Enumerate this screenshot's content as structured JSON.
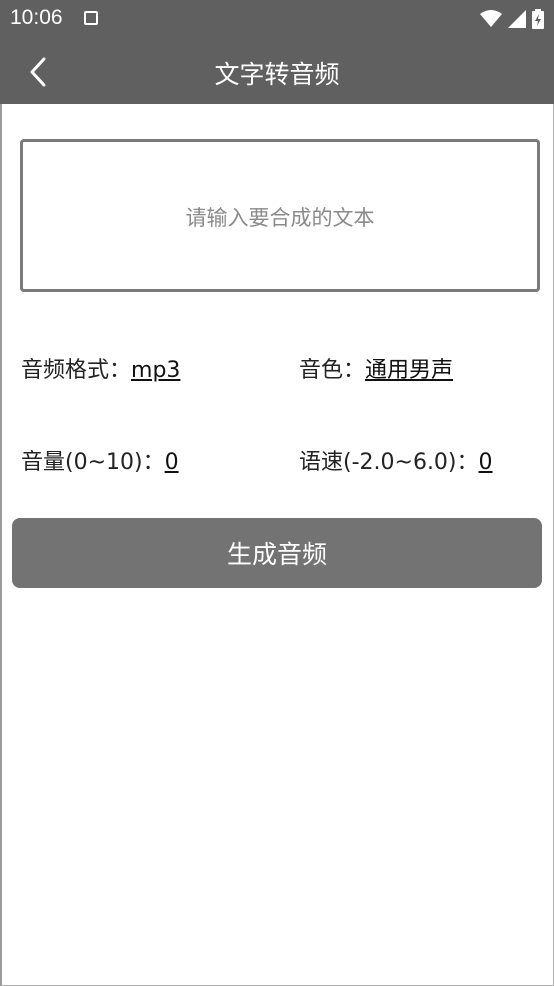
{
  "status_bar": {
    "time": "10:06"
  },
  "app_bar": {
    "title": "文字转音频",
    "back_icon": "chevron-left-icon"
  },
  "text_input": {
    "placeholder": "请输入要合成的文本",
    "value": ""
  },
  "options": {
    "format_label": "音频格式：",
    "format_value": "mp3",
    "voice_label": "音色：",
    "voice_value": "通用男声",
    "volume_label": "音量(0~10)：",
    "volume_value": "0",
    "speed_label": "语速(-2.0~6.0)：",
    "speed_value": "0"
  },
  "actions": {
    "generate_label": "生成音频"
  },
  "colors": {
    "bar": "#606060",
    "button": "#737373"
  }
}
